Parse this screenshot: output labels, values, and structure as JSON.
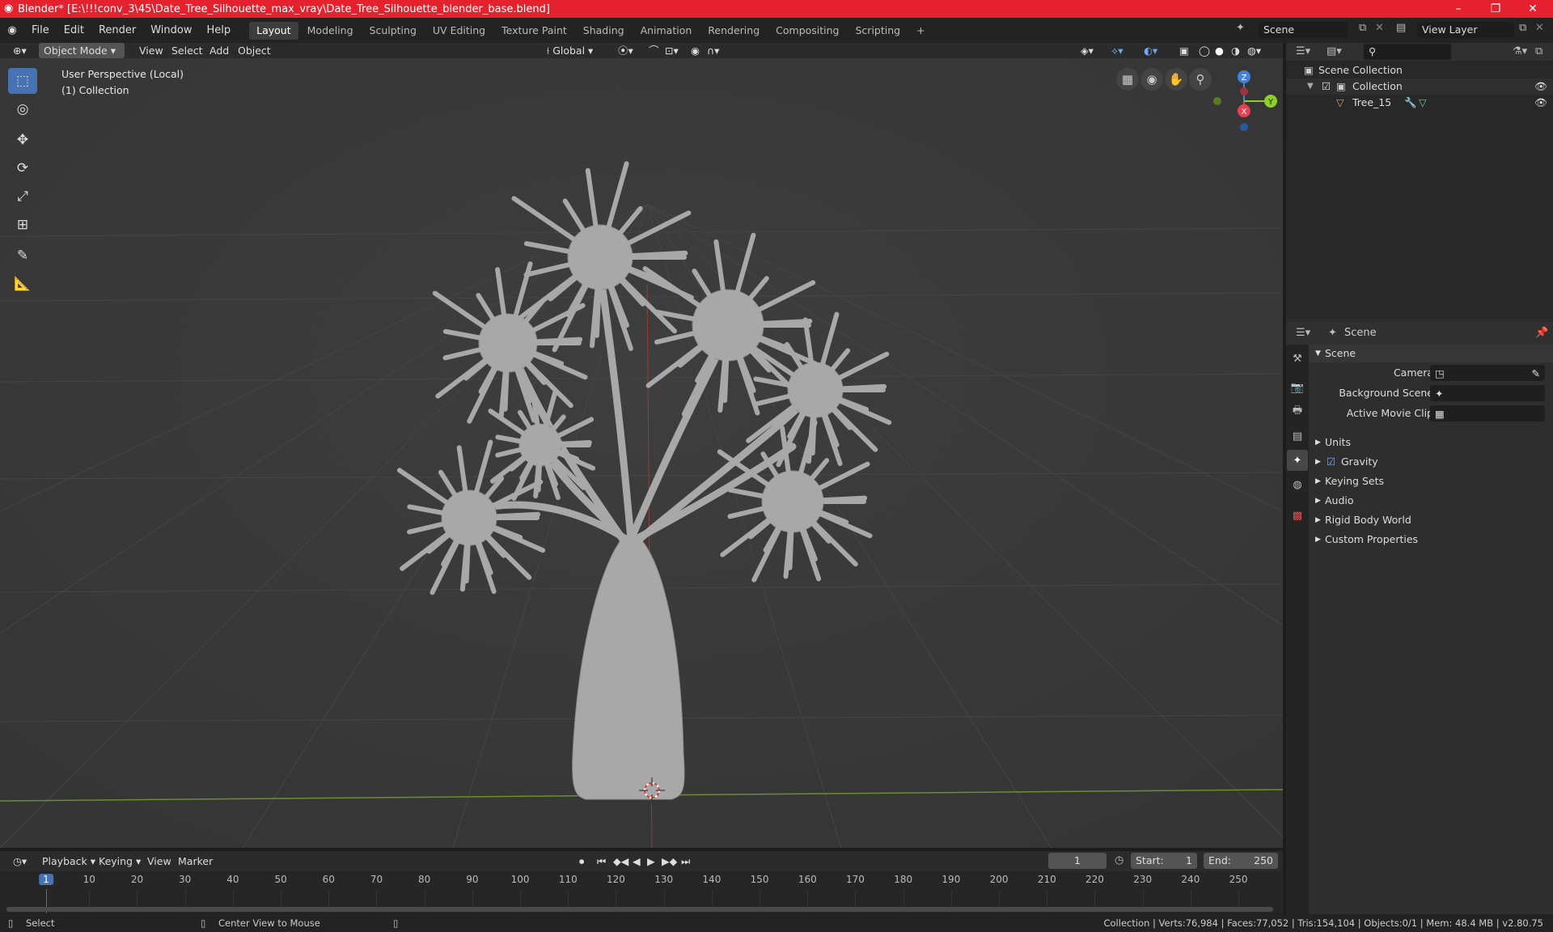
{
  "window": {
    "title": "Blender* [E:\\!!!conv_3\\45\\Date_Tree_Silhouette_max_vray\\Date_Tree_Silhouette_blender_base.blend]",
    "minimize": "–",
    "maximize": "❐",
    "close": "✕"
  },
  "menu": [
    "File",
    "Edit",
    "Render",
    "Window",
    "Help"
  ],
  "workspaces": [
    "Layout",
    "Modeling",
    "Sculpting",
    "UV Editing",
    "Texture Paint",
    "Shading",
    "Animation",
    "Rendering",
    "Compositing",
    "Scripting"
  ],
  "workspace_add": "+",
  "scene_name": "Scene",
  "view_layer_name": "View Layer",
  "viewport": {
    "mode": "Object Mode",
    "menus": [
      "View",
      "Select",
      "Add",
      "Object"
    ],
    "transform_orientation": "Global",
    "overlay_line1": "User Perspective (Local)",
    "overlay_line2": "(1) Collection"
  },
  "gizmo": {
    "z": "Z",
    "y": "Y",
    "x": "X"
  },
  "outliner": {
    "root": "Scene Collection",
    "collection": "Collection",
    "object": "Tree_15"
  },
  "properties": {
    "header": "Scene",
    "panel": "Scene",
    "camera_label": "Camera",
    "bg_label": "Background Scene",
    "clip_label": "Active Movie Clip",
    "sections": [
      "Units",
      "Gravity",
      "Keying Sets",
      "Audio",
      "Rigid Body World",
      "Custom Properties"
    ]
  },
  "timeline": {
    "menus": [
      "Playback",
      "Keying",
      "View",
      "Marker"
    ],
    "current_frame": "1",
    "start_label": "Start:",
    "start": "1",
    "end_label": "End:",
    "end": "250",
    "ticks": [
      "1",
      "10",
      "20",
      "30",
      "40",
      "50",
      "60",
      "70",
      "80",
      "90",
      "100",
      "110",
      "120",
      "130",
      "140",
      "150",
      "160",
      "170",
      "180",
      "190",
      "200",
      "210",
      "220",
      "230",
      "240",
      "250"
    ]
  },
  "status": {
    "select": "Select",
    "center": "Center View to Mouse",
    "stats": "Collection | Verts:76,984 | Faces:77,052 | Tris:154,104 | Objects:0/1 | Mem: 48.4 MB | v2.80.75"
  },
  "colors": {
    "title_red": "#e6212e",
    "active_blue": "#4772b3",
    "axis_x": "#e8404f",
    "axis_y": "#8ccf2b",
    "axis_z": "#3f82e0"
  }
}
